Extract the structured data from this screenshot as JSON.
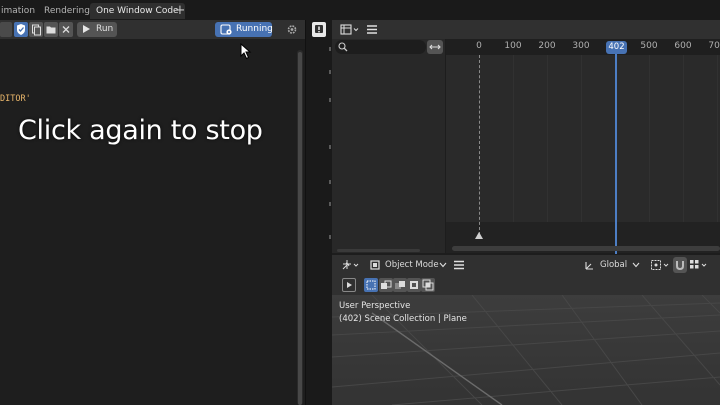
{
  "workspace_tabs": [
    {
      "label": "imation",
      "active": false
    },
    {
      "label": "Rendering",
      "active": false
    },
    {
      "label": "One Window Code",
      "active": true
    }
  ],
  "add_tab_label": "+",
  "editor": {
    "run_label": "Run",
    "running_label": "Running",
    "code_text": "DITOR'",
    "overlay_message": "Click again to stop"
  },
  "timeline": {
    "ticks": [
      "0",
      "100",
      "200",
      "300",
      "400",
      "500",
      "600",
      "700"
    ],
    "current_frame": "402"
  },
  "viewport": {
    "mode_label": "Object Mode",
    "orientation_label": "Global",
    "view_name": "User Perspective",
    "collection_info": "(402) Scene Collection | Plane"
  },
  "colors": {
    "accent": "#4772b3",
    "code_string": "#e8b56a",
    "playhead": "#4d7ec4"
  },
  "icons": [
    "shield-icon",
    "new-file-icon",
    "folder-icon",
    "close-icon",
    "play-icon",
    "script-icon",
    "gear-icon",
    "info-icon",
    "editor-type-icon",
    "menu-icon",
    "search-icon",
    "swap-icon",
    "transform-icon",
    "object-mode-icon",
    "select-mode-icon"
  ]
}
